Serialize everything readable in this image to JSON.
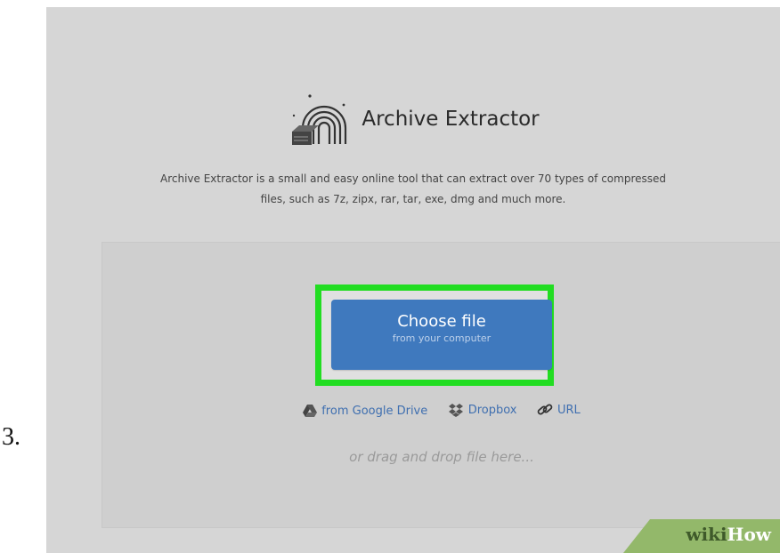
{
  "step_number": "3.",
  "app": {
    "title": "Archive Extractor",
    "description": "Archive Extractor is a small and easy online tool that can extract over 70 types of compressed files, such as 7z, zipx, rar, tar, exe, dmg and much more.",
    "logo_icon": "rainbow-box-icon"
  },
  "upload": {
    "button_title": "Choose file",
    "button_subtitle": "from your computer",
    "sources": [
      {
        "label": "from Google Drive",
        "icon": "google-drive-icon"
      },
      {
        "label": "Dropbox",
        "icon": "dropbox-icon"
      },
      {
        "label": "URL",
        "icon": "link-icon"
      }
    ],
    "drop_hint": "or drag and drop file here..."
  },
  "watermark": {
    "wiki": "wiki",
    "how": "How"
  },
  "colors": {
    "button_blue": "#3f79be",
    "highlight_green": "#22dd22",
    "link_blue": "#3f6fb0",
    "background_gray": "#d6d6d6"
  }
}
